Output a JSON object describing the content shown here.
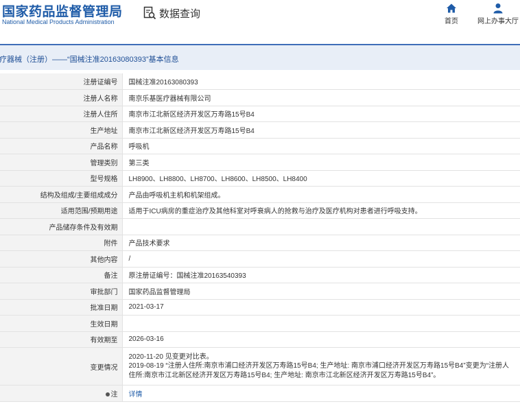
{
  "header": {
    "brand_cn": "国家药品监督管理局",
    "brand_en": "National Medical Products Administration",
    "data_query": "数据查询",
    "nav": [
      {
        "label": "首页",
        "icon": "home-icon"
      },
      {
        "label": "网上办事大厅",
        "icon": "user-icon"
      }
    ]
  },
  "title": "疗器械（注册）——“国械注准20163080393”基本信息",
  "fields": [
    {
      "label": "注册证编号",
      "value": "国械注准20163080393"
    },
    {
      "label": "注册人名称",
      "value": "南京乐基医疗器械有限公司"
    },
    {
      "label": "注册人住所",
      "value": "南京市江北新区经济开发区万寿路15号B4"
    },
    {
      "label": "生产地址",
      "value": "南京市江北新区经济开发区万寿路15号B4"
    },
    {
      "label": "产品名称",
      "value": "呼吸机"
    },
    {
      "label": "管理类别",
      "value": "第三类"
    },
    {
      "label": "型号规格",
      "value": "LH8900、LH8800、LH8700、LH8600、LH8500、LH8400"
    },
    {
      "label": "结构及组成/主要组成成分",
      "value": "产品由呼吸机主机和机架组成。"
    },
    {
      "label": "适用范围/预期用途",
      "value": "适用于ICU病房的重症治疗及其他科室对呼衰病人的抢救与治疗及医疗机构对患者进行呼吸支持。"
    },
    {
      "label": "产品储存条件及有效期",
      "value": ""
    },
    {
      "label": "附件",
      "value": "产品技术要求"
    },
    {
      "label": "其他内容",
      "value": "/"
    },
    {
      "label": "备注",
      "value": "原注册证编号：国械注准20163540393"
    },
    {
      "label": "审批部门",
      "value": "国家药品监督管理局"
    },
    {
      "label": "批准日期",
      "value": "2021-03-17"
    },
    {
      "label": "生效日期",
      "value": ""
    },
    {
      "label": "有效期至",
      "value": "2026-03-16"
    }
  ],
  "change": {
    "label": "变更情况",
    "lines": [
      "2020-11-20 见变更对比表。",
      "2019-08-19 “注册人住所:南京市浦口经济开发区万寿路15号B4; 生产地址: 南京市浦口经济开发区万寿路15号B4”变更为“注册人",
      "住所:南京市江北新区经济开发区万寿路15号B4; 生产地址: 南京市江北新区经济开发区万寿路15号B4”。"
    ]
  },
  "note": {
    "label": "注",
    "link": "详情"
  }
}
